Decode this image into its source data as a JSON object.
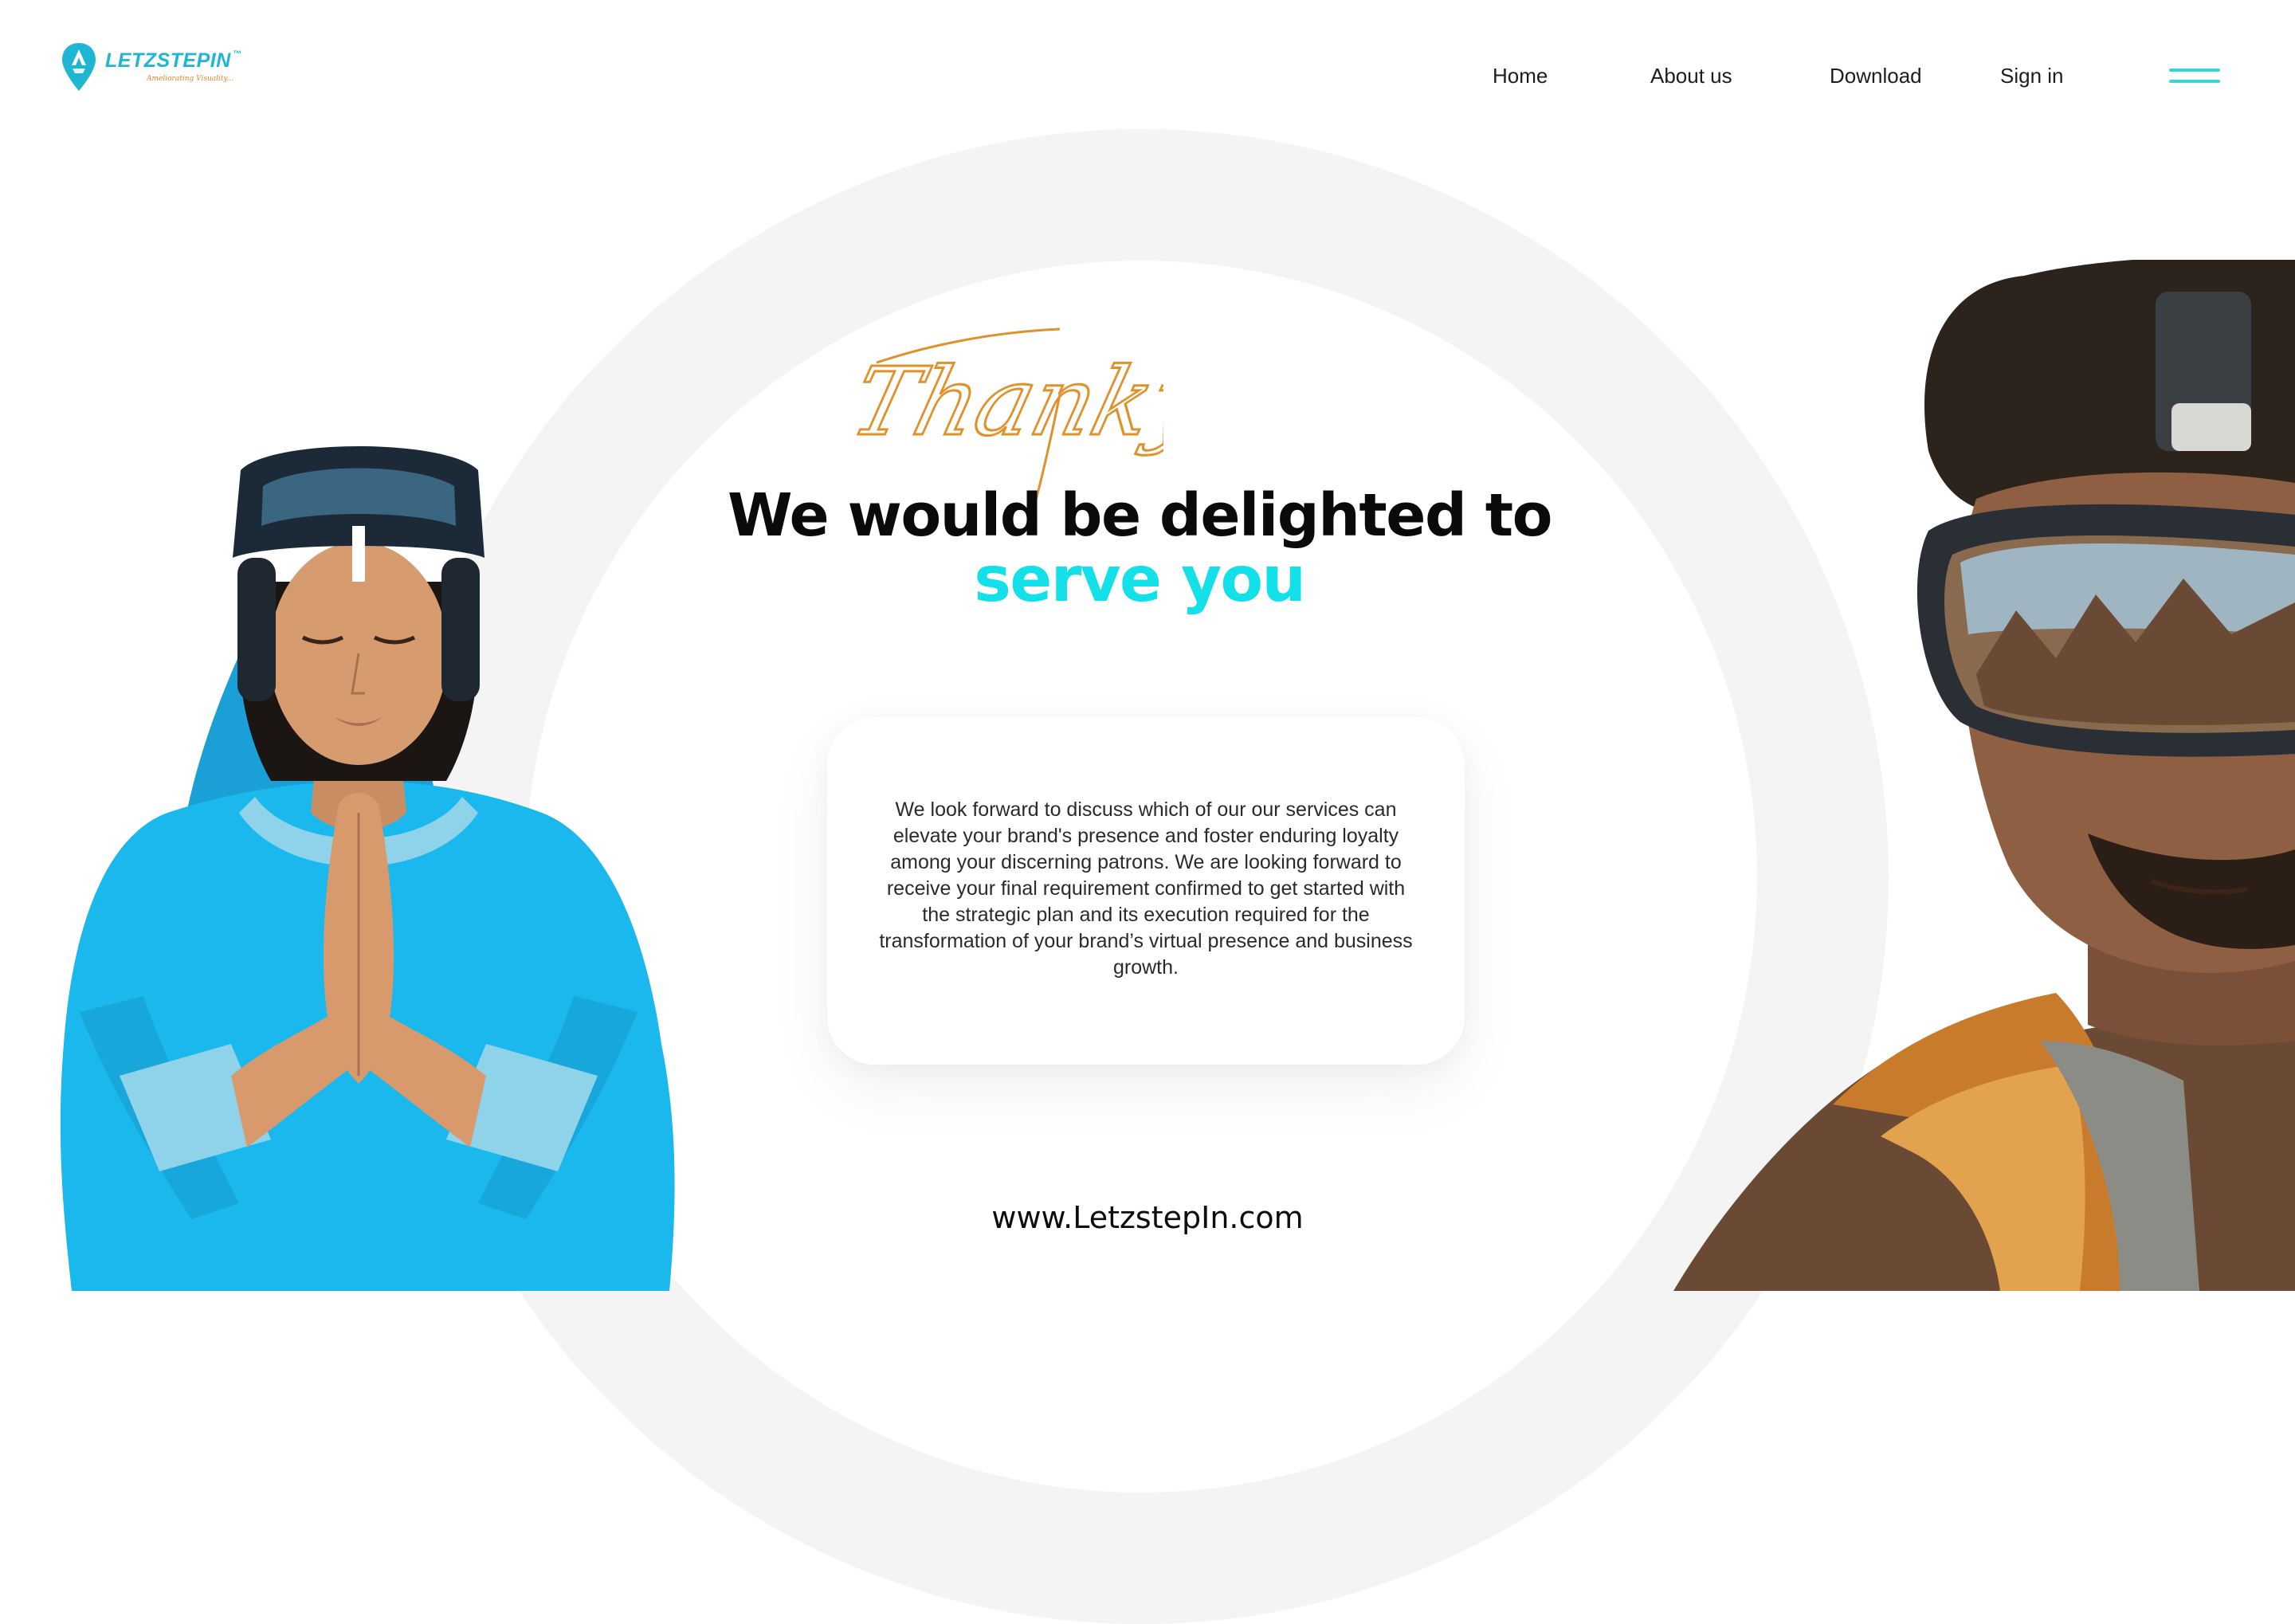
{
  "brand": {
    "name": "LETZSTEPIN",
    "trademark": "™",
    "tagline": "Ameliorating Visuality...",
    "colors": {
      "primary": "#1fb6d4",
      "accent": "#13e0e8",
      "tagline": "#d98a2a"
    }
  },
  "nav": {
    "items": [
      {
        "label": "Home"
      },
      {
        "label": "About us"
      },
      {
        "label": "Download"
      },
      {
        "label": "Sign in"
      }
    ],
    "menu_icon": "hamburger-icon"
  },
  "hero": {
    "script_text": "Thankyou",
    "headline": "We would be delighted to",
    "headline_accent": "serve you",
    "body": "We look forward to discuss which of our our services can elevate your brand's presence and foster enduring loyalty among your discerning patrons. We are looking forward to receive your final requirement confirmed to get started with the strategic plan and its execution required for the transformation of your brand’s virtual presence and business growth.",
    "colors": {
      "script": "#e0922a",
      "headline": "#0a0a0a",
      "accent": "#13e0e8"
    }
  },
  "footer": {
    "url": "www.LetzstepIn.com"
  },
  "images": {
    "left": "woman-vr-headset-namaste",
    "right": "man-vr-headset-scarf"
  }
}
